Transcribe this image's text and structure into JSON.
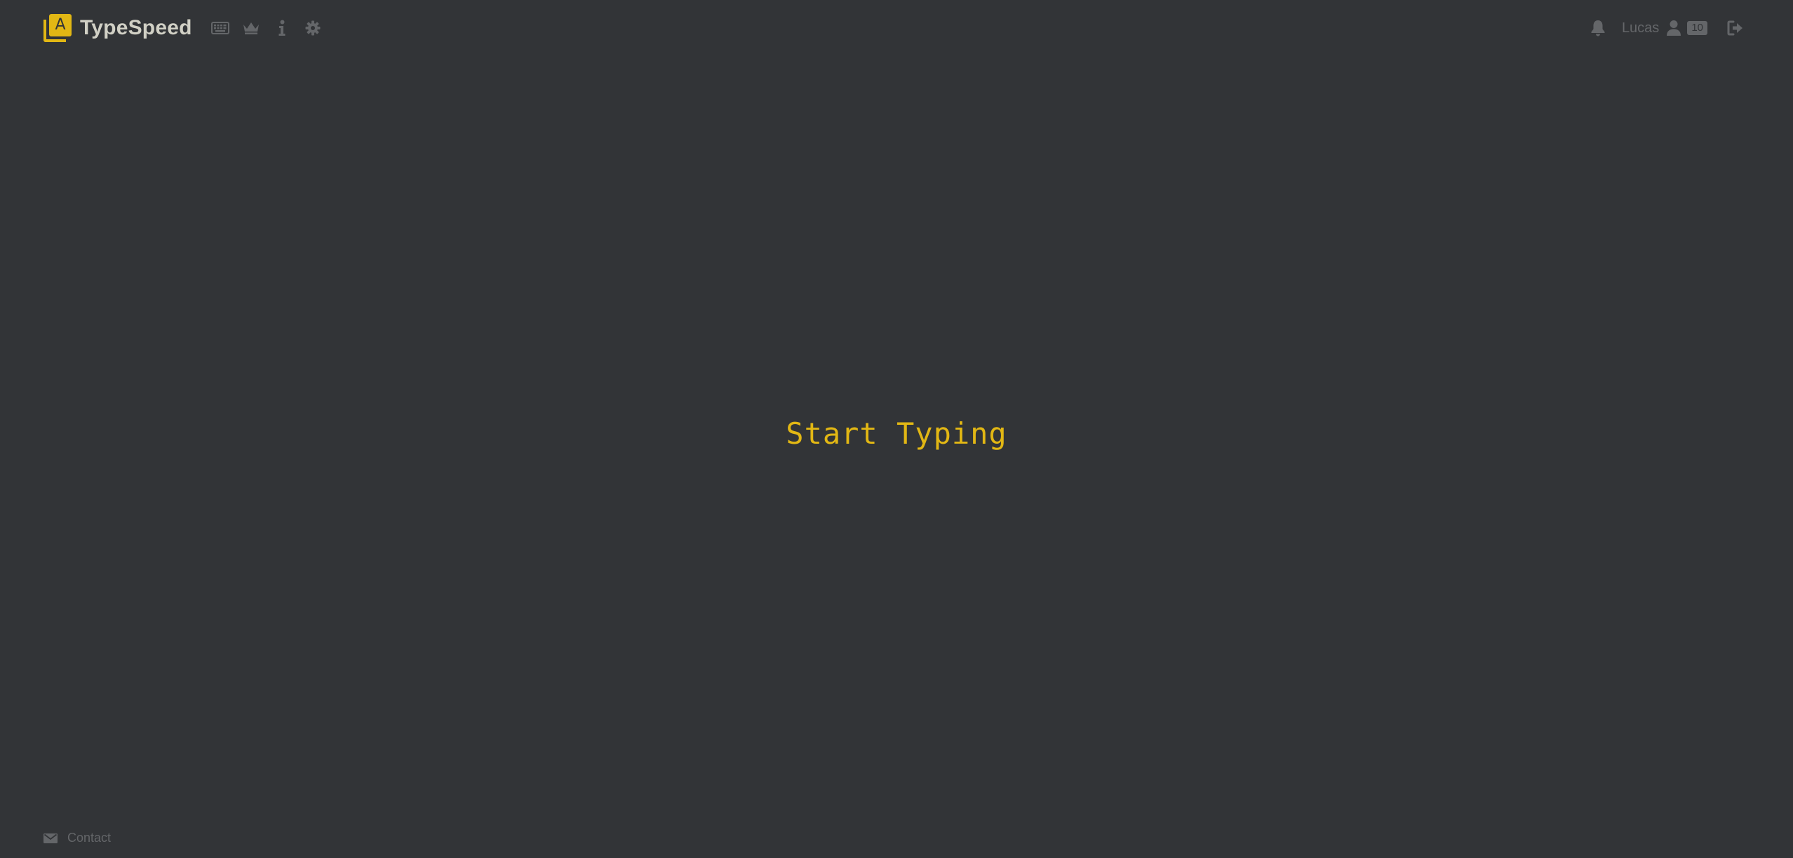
{
  "app": {
    "name": "TypeSpeed",
    "logo_letter": "A",
    "accent_color": "#e2b714",
    "background_color": "#323437",
    "muted_color": "#646669",
    "text_color": "#d1d0c5"
  },
  "nav": {
    "items": [
      {
        "icon": "keyboard-icon"
      },
      {
        "icon": "crown-icon"
      },
      {
        "icon": "info-icon"
      },
      {
        "icon": "gear-icon"
      }
    ]
  },
  "account": {
    "notification_icon": "bell-icon",
    "username": "Lucas",
    "profile_icon": "user-icon",
    "level": "10",
    "logout_icon": "sign-out-icon"
  },
  "main": {
    "prompt": "Start Typing"
  },
  "footer": {
    "contact_icon": "envelope-icon",
    "contact_label": "Contact"
  }
}
